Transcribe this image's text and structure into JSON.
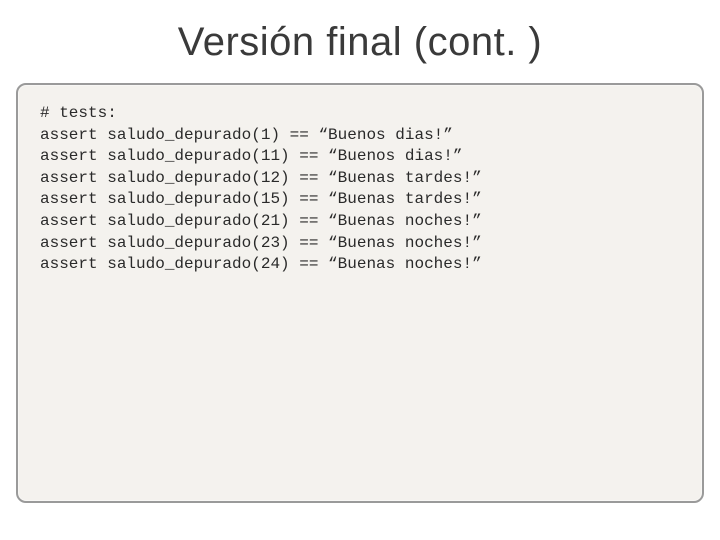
{
  "slide": {
    "title": "Versión final (cont. )"
  },
  "code": {
    "comment": "# tests:",
    "lines": [
      "assert saludo_depurado(1) == “Buenos dias!”",
      "assert saludo_depurado(11) == “Buenos dias!”",
      "assert saludo_depurado(12) == “Buenas tardes!”",
      "assert saludo_depurado(15) == “Buenas tardes!”",
      "assert saludo_depurado(21) == “Buenas noches!”",
      "assert saludo_depurado(23) == “Buenas noches!”",
      "assert saludo_depurado(24) == “Buenas noches!”"
    ]
  }
}
